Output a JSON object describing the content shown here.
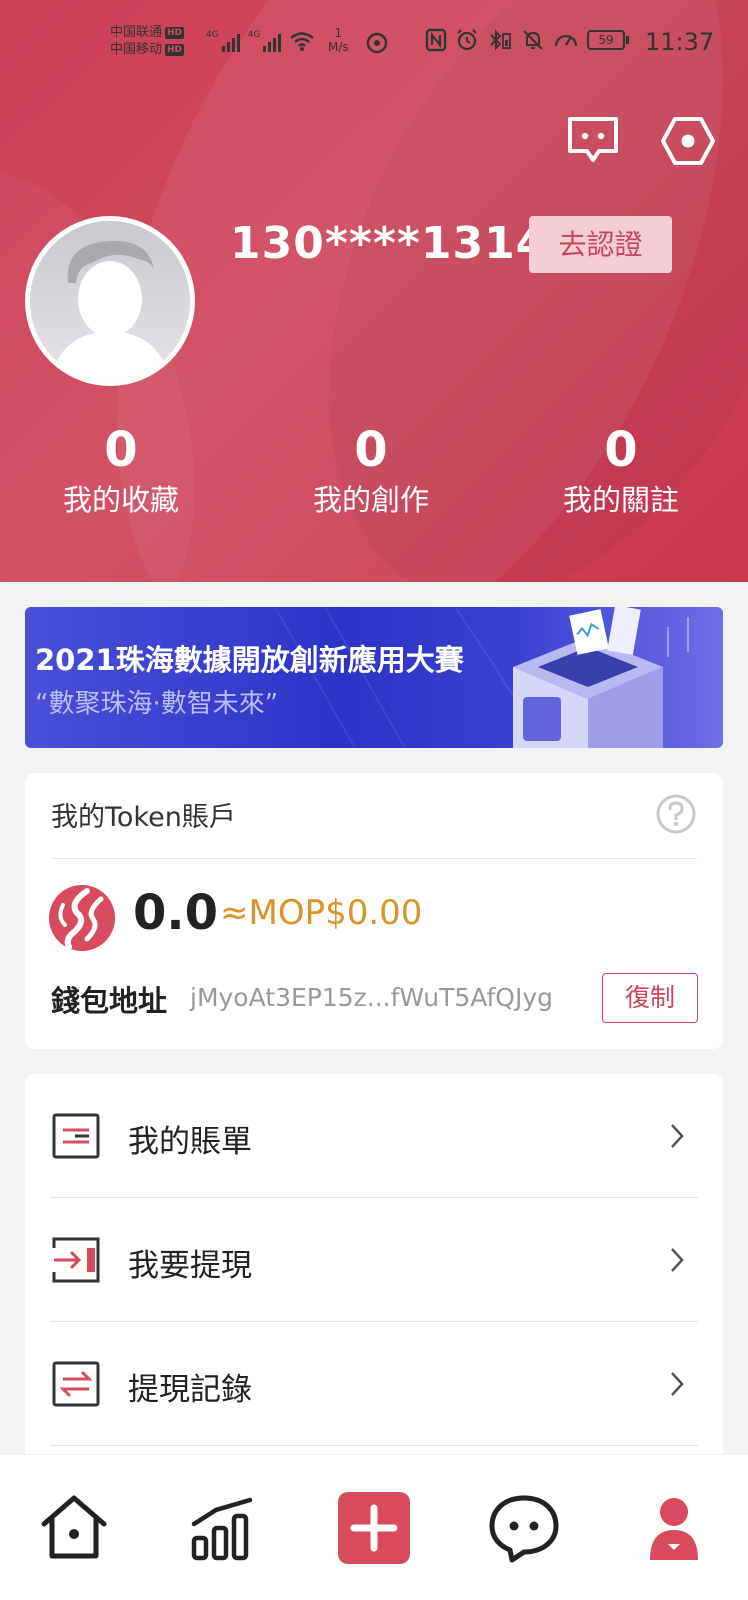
{
  "status_bar": {
    "carrier1": "中国联通",
    "carrier2": "中国移动",
    "hd": "HD",
    "network1": "4G",
    "network2": "4G",
    "speed_value": "1",
    "speed_unit": "M/s",
    "battery": "59",
    "time": "11:37"
  },
  "profile": {
    "phone": "130****1314",
    "verify_label": "去認證"
  },
  "stats": [
    {
      "count": "0",
      "label": "我的收藏"
    },
    {
      "count": "0",
      "label": "我的創作"
    },
    {
      "count": "0",
      "label": "我的關註"
    }
  ],
  "banner": {
    "title": "2021珠海數據開放創新應用大賽",
    "subtitle": "“數聚珠海·數智未來”"
  },
  "token": {
    "title": "我的Token賬戶",
    "balance": "0.0",
    "mop": "≈MOP$0.00",
    "wallet_label": "錢包地址",
    "wallet_address": "jMyoAt3EP15z...fWuT5AfQJyg",
    "copy_label": "復制"
  },
  "menu": [
    {
      "label": "我的賬單",
      "icon": "bill-icon"
    },
    {
      "label": "我要提現",
      "icon": "withdraw-icon"
    },
    {
      "label": "提現記錄",
      "icon": "withdraw-record-icon"
    }
  ],
  "nav": [
    "home-icon",
    "chart-icon",
    "plus-icon",
    "chat-icon",
    "profile-icon"
  ],
  "colors": {
    "primary": "#cc4058",
    "accent_gold": "#d9932a",
    "banner_blue": "#2d33c6"
  }
}
